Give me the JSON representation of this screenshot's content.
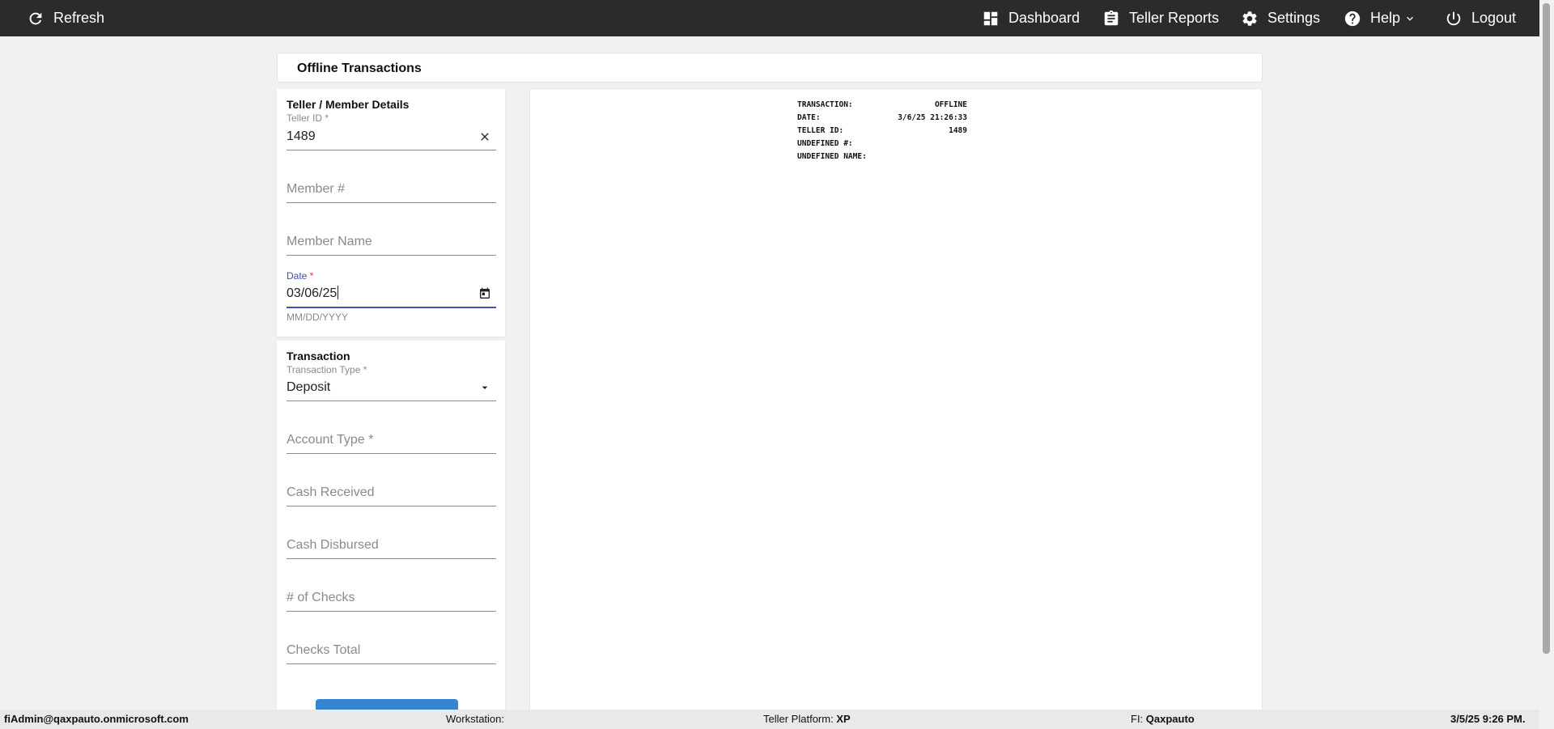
{
  "topbar": {
    "refresh_label": "Refresh",
    "dashboard_label": "Dashboard",
    "teller_reports_label": "Teller Reports",
    "settings_label": "Settings",
    "help_label": "Help",
    "logout_label": "Logout",
    "background": "#2b2b2b"
  },
  "page": {
    "title": "Offline Transactions"
  },
  "member_details": {
    "title": "Teller / Member Details",
    "teller_id": {
      "label": "Teller ID",
      "required_mark": "*",
      "value": "1489"
    },
    "member_number": {
      "placeholder": "Member #"
    },
    "member_name": {
      "placeholder": "Member Name"
    },
    "date": {
      "label": "Date",
      "required_mark": "*",
      "value": "03/06/25",
      "hint": "MM/DD/YYYY"
    }
  },
  "transaction": {
    "title": "Transaction",
    "transaction_type": {
      "label": "Transaction Type",
      "required_mark": "*",
      "value": "Deposit"
    },
    "account_type": {
      "placeholder": "Account Type *"
    },
    "cash_received": {
      "placeholder": "Cash Received"
    },
    "cash_disbursed": {
      "placeholder": "Cash Disbursed"
    },
    "num_checks": {
      "placeholder": "# of Checks"
    },
    "checks_total": {
      "placeholder": "Checks Total"
    }
  },
  "receipt": {
    "lines": [
      {
        "label": "TRANSACTION:",
        "value": "OFFLINE"
      },
      {
        "label": "DATE:",
        "value": "3/6/25 21:26:33"
      },
      {
        "label": "TELLER ID:",
        "value": "1489"
      },
      {
        "label": "UNDEFINED #:",
        "value": ""
      },
      {
        "label": "UNDEFINED NAME:",
        "value": ""
      }
    ]
  },
  "statusbar": {
    "user": "fiAdmin@qaxpauto.onmicrosoft.com",
    "workstation_label": "Workstation:",
    "workstation_value": "",
    "platform_label": "Teller Platform:",
    "platform_value": "XP",
    "fi_label": "FI:",
    "fi_value": "Qaxpauto",
    "datetime": "3/5/25 9:26 PM."
  },
  "colors": {
    "accent": "#3f51b5",
    "button": "#3584d2",
    "required": "#e53935"
  }
}
